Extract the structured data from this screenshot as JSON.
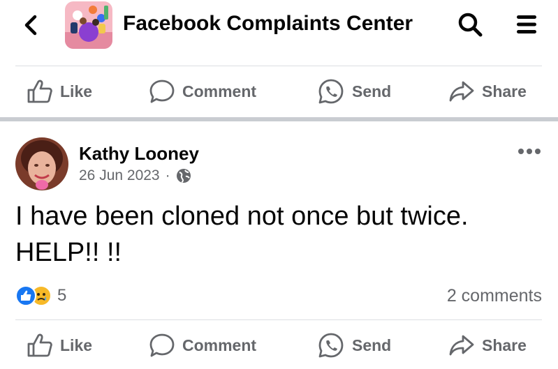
{
  "header": {
    "title": "Facebook Complaints Center",
    "back_icon": "chevron-left-icon",
    "search_icon": "search-icon",
    "menu_icon": "hamburger-menu-icon"
  },
  "top_actions": {
    "like": "Like",
    "comment": "Comment",
    "send": "Send",
    "share": "Share"
  },
  "post": {
    "author": "Kathy Looney",
    "date": "26 Jun 2023",
    "separator": "·",
    "privacy_icon": "globe-icon",
    "text": "I have been cloned not once but twice.\nHELP!!   !!",
    "reactions": {
      "types": [
        "like",
        "sad"
      ],
      "count": "5"
    },
    "comments": "2 comments"
  },
  "bottom_actions": {
    "like": "Like",
    "comment": "Comment",
    "send": "Send",
    "share": "Share"
  },
  "colors": {
    "like_blue": "#1877f2",
    "sad_yellow": "#f7b928",
    "secondary_text": "#65676b",
    "separator": "#c9ccd1"
  }
}
